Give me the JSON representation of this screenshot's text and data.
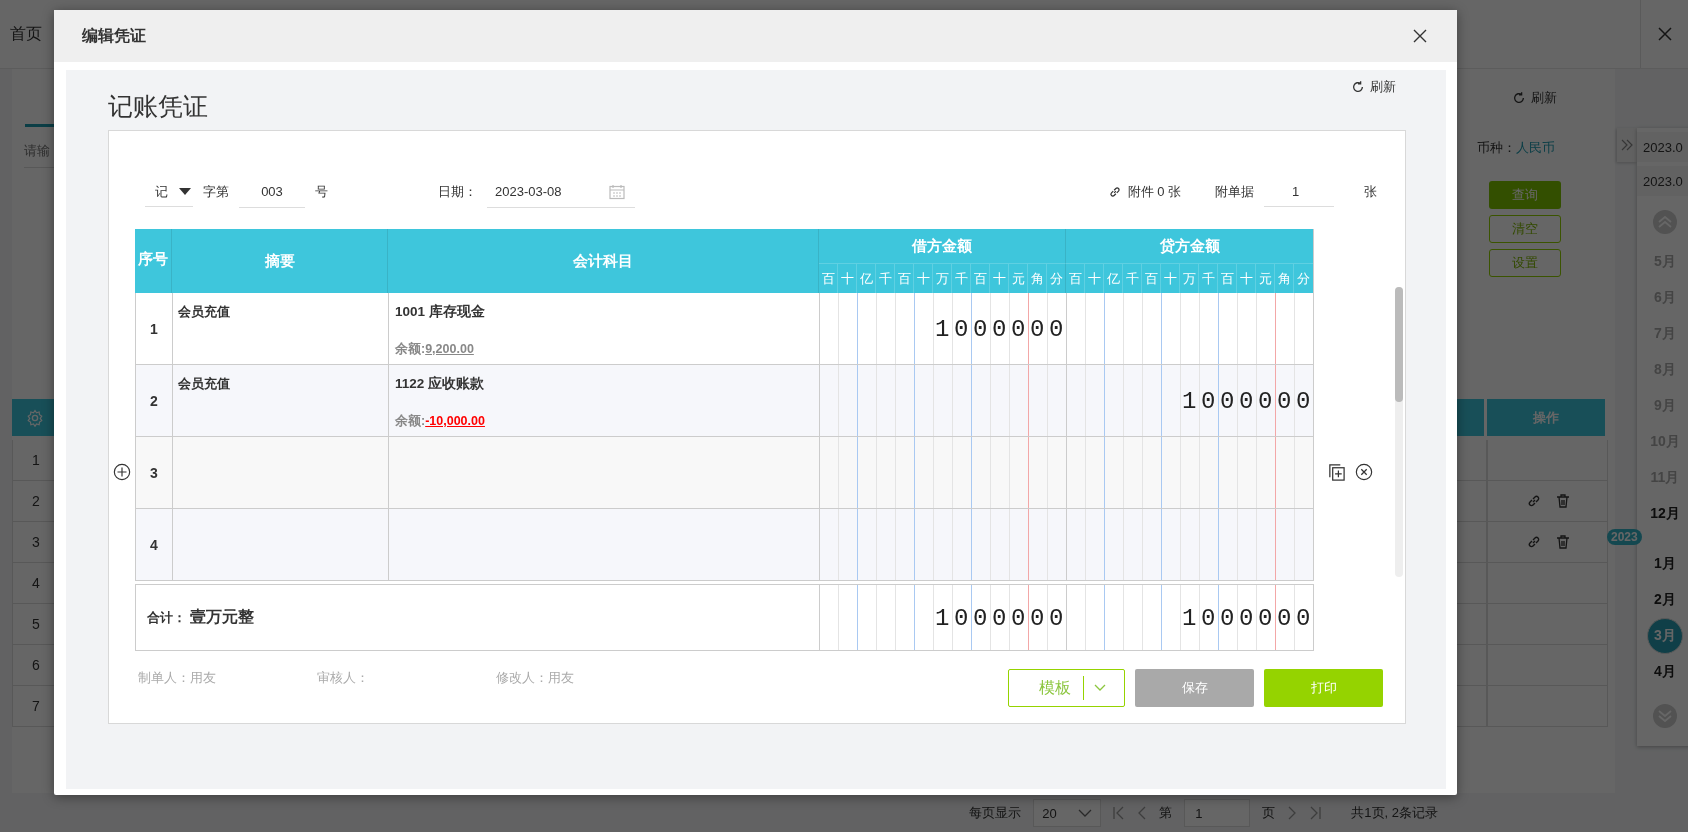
{
  "background": {
    "home_tab": "首页",
    "search": {
      "placeholder": "请输"
    },
    "refresh": "刷新",
    "currency": {
      "label": "币种：",
      "value": "人民币"
    },
    "filter_buttons": [
      {
        "label": "查询",
        "kind": "primary"
      },
      {
        "label": "清空",
        "kind": "outline"
      },
      {
        "label": "设置",
        "kind": "outline"
      }
    ],
    "table": {
      "action_header": "操作",
      "rows": [
        {
          "index": "1",
          "actions": false
        },
        {
          "index": "2",
          "actions": true
        },
        {
          "index": "3",
          "actions": true
        },
        {
          "index": "4",
          "actions": false
        },
        {
          "index": "5",
          "actions": false
        },
        {
          "index": "6",
          "actions": false
        },
        {
          "index": "7",
          "actions": false
        }
      ]
    },
    "pager": {
      "per_page_label": "每页显示",
      "per_page": "20",
      "page_prefix": "第",
      "page": "1",
      "page_suffix": "页",
      "summary": "共1页, 2条记录"
    },
    "period_panel": {
      "dates": [
        "2023.0",
        "2023.0"
      ],
      "items": [
        {
          "kind": "month",
          "label": "5月",
          "disabled": true,
          "selected": false
        },
        {
          "kind": "month",
          "label": "6月",
          "disabled": true,
          "selected": false
        },
        {
          "kind": "month",
          "label": "7月",
          "disabled": true,
          "selected": false
        },
        {
          "kind": "month",
          "label": "8月",
          "disabled": true,
          "selected": false
        },
        {
          "kind": "month",
          "label": "9月",
          "disabled": true,
          "selected": false
        },
        {
          "kind": "month",
          "label": "10月",
          "disabled": true,
          "selected": false
        },
        {
          "kind": "month",
          "label": "11月",
          "disabled": true,
          "selected": false
        },
        {
          "kind": "month",
          "label": "12月",
          "disabled": false,
          "selected": false
        },
        {
          "kind": "year",
          "label": "2023"
        },
        {
          "kind": "month",
          "label": "1月",
          "disabled": false,
          "selected": false
        },
        {
          "kind": "month",
          "label": "2月",
          "disabled": false,
          "selected": false
        },
        {
          "kind": "month",
          "label": "3月",
          "disabled": false,
          "selected": true
        },
        {
          "kind": "month",
          "label": "4月",
          "disabled": false,
          "selected": false
        }
      ]
    }
  },
  "dialog": {
    "title": "编辑凭证",
    "heading": "记账凭证",
    "refresh": "刷新",
    "voucher_word": "记",
    "word_suffix": "字第",
    "number": "003",
    "number_suffix": "号",
    "date_label": "日期：",
    "date": "2023-03-08",
    "attachment": "附件 0 张",
    "doc_label": "附单据",
    "doc_count": "1",
    "doc_unit": "张",
    "columns": {
      "index": "序号",
      "summary": "摘要",
      "account": "会计科目",
      "debit": "借方金额",
      "credit": "贷方金额",
      "debit_digits": [
        "百",
        "十",
        "亿",
        "千",
        "百",
        "十",
        "万",
        "千",
        "百",
        "十",
        "元",
        "角",
        "分"
      ],
      "credit_digits": [
        "百",
        "十",
        "亿",
        "千",
        "百",
        "十",
        "万",
        "千",
        "百",
        "十",
        "元",
        "角",
        "分"
      ]
    },
    "rows": [
      {
        "index": "1",
        "summary": "会员充值",
        "account": "1001 库存现金",
        "balance_label": "余额:",
        "balance": "9,200.00",
        "negative": false,
        "debit": "1000000",
        "hovered": false
      },
      {
        "index": "2",
        "summary": "会员充值",
        "account": "1122 应收账款",
        "balance_label": "余额:",
        "balance": "-10,000.00",
        "negative": true,
        "credit": "1000000",
        "hovered": false
      },
      {
        "index": "3",
        "hovered": true
      },
      {
        "index": "4",
        "hovered": false
      }
    ],
    "total": {
      "label": "合计：",
      "words": "壹万元整",
      "debit": "1000000",
      "credit": "1000000"
    },
    "signatures": [
      {
        "label": "制单人：",
        "value": "用友"
      },
      {
        "label": "审核人："
      },
      {
        "label": "修改人：",
        "value": "用友"
      }
    ],
    "buttons": {
      "template": "模板",
      "save": "保存",
      "save_disabled": true,
      "print": "打印"
    }
  }
}
